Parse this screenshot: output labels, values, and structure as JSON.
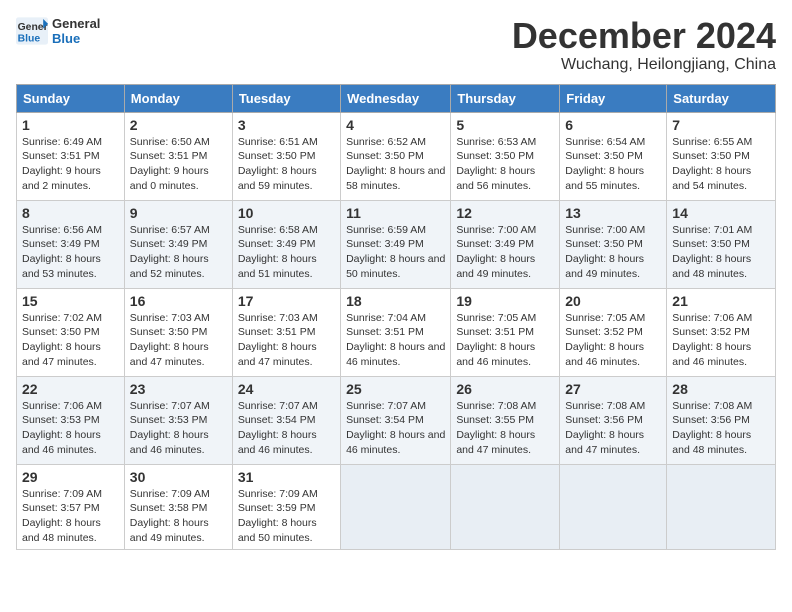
{
  "header": {
    "logo_general": "General",
    "logo_blue": "Blue",
    "month_title": "December 2024",
    "subtitle": "Wuchang, Heilongjiang, China"
  },
  "columns": [
    "Sunday",
    "Monday",
    "Tuesday",
    "Wednesday",
    "Thursday",
    "Friday",
    "Saturday"
  ],
  "weeks": [
    [
      {
        "day": "1",
        "sunrise": "Sunrise: 6:49 AM",
        "sunset": "Sunset: 3:51 PM",
        "daylight": "Daylight: 9 hours and 2 minutes."
      },
      {
        "day": "2",
        "sunrise": "Sunrise: 6:50 AM",
        "sunset": "Sunset: 3:51 PM",
        "daylight": "Daylight: 9 hours and 0 minutes."
      },
      {
        "day": "3",
        "sunrise": "Sunrise: 6:51 AM",
        "sunset": "Sunset: 3:50 PM",
        "daylight": "Daylight: 8 hours and 59 minutes."
      },
      {
        "day": "4",
        "sunrise": "Sunrise: 6:52 AM",
        "sunset": "Sunset: 3:50 PM",
        "daylight": "Daylight: 8 hours and 58 minutes."
      },
      {
        "day": "5",
        "sunrise": "Sunrise: 6:53 AM",
        "sunset": "Sunset: 3:50 PM",
        "daylight": "Daylight: 8 hours and 56 minutes."
      },
      {
        "day": "6",
        "sunrise": "Sunrise: 6:54 AM",
        "sunset": "Sunset: 3:50 PM",
        "daylight": "Daylight: 8 hours and 55 minutes."
      },
      {
        "day": "7",
        "sunrise": "Sunrise: 6:55 AM",
        "sunset": "Sunset: 3:50 PM",
        "daylight": "Daylight: 8 hours and 54 minutes."
      }
    ],
    [
      {
        "day": "8",
        "sunrise": "Sunrise: 6:56 AM",
        "sunset": "Sunset: 3:49 PM",
        "daylight": "Daylight: 8 hours and 53 minutes."
      },
      {
        "day": "9",
        "sunrise": "Sunrise: 6:57 AM",
        "sunset": "Sunset: 3:49 PM",
        "daylight": "Daylight: 8 hours and 52 minutes."
      },
      {
        "day": "10",
        "sunrise": "Sunrise: 6:58 AM",
        "sunset": "Sunset: 3:49 PM",
        "daylight": "Daylight: 8 hours and 51 minutes."
      },
      {
        "day": "11",
        "sunrise": "Sunrise: 6:59 AM",
        "sunset": "Sunset: 3:49 PM",
        "daylight": "Daylight: 8 hours and 50 minutes."
      },
      {
        "day": "12",
        "sunrise": "Sunrise: 7:00 AM",
        "sunset": "Sunset: 3:49 PM",
        "daylight": "Daylight: 8 hours and 49 minutes."
      },
      {
        "day": "13",
        "sunrise": "Sunrise: 7:00 AM",
        "sunset": "Sunset: 3:50 PM",
        "daylight": "Daylight: 8 hours and 49 minutes."
      },
      {
        "day": "14",
        "sunrise": "Sunrise: 7:01 AM",
        "sunset": "Sunset: 3:50 PM",
        "daylight": "Daylight: 8 hours and 48 minutes."
      }
    ],
    [
      {
        "day": "15",
        "sunrise": "Sunrise: 7:02 AM",
        "sunset": "Sunset: 3:50 PM",
        "daylight": "Daylight: 8 hours and 47 minutes."
      },
      {
        "day": "16",
        "sunrise": "Sunrise: 7:03 AM",
        "sunset": "Sunset: 3:50 PM",
        "daylight": "Daylight: 8 hours and 47 minutes."
      },
      {
        "day": "17",
        "sunrise": "Sunrise: 7:03 AM",
        "sunset": "Sunset: 3:51 PM",
        "daylight": "Daylight: 8 hours and 47 minutes."
      },
      {
        "day": "18",
        "sunrise": "Sunrise: 7:04 AM",
        "sunset": "Sunset: 3:51 PM",
        "daylight": "Daylight: 8 hours and 46 minutes."
      },
      {
        "day": "19",
        "sunrise": "Sunrise: 7:05 AM",
        "sunset": "Sunset: 3:51 PM",
        "daylight": "Daylight: 8 hours and 46 minutes."
      },
      {
        "day": "20",
        "sunrise": "Sunrise: 7:05 AM",
        "sunset": "Sunset: 3:52 PM",
        "daylight": "Daylight: 8 hours and 46 minutes."
      },
      {
        "day": "21",
        "sunrise": "Sunrise: 7:06 AM",
        "sunset": "Sunset: 3:52 PM",
        "daylight": "Daylight: 8 hours and 46 minutes."
      }
    ],
    [
      {
        "day": "22",
        "sunrise": "Sunrise: 7:06 AM",
        "sunset": "Sunset: 3:53 PM",
        "daylight": "Daylight: 8 hours and 46 minutes."
      },
      {
        "day": "23",
        "sunrise": "Sunrise: 7:07 AM",
        "sunset": "Sunset: 3:53 PM",
        "daylight": "Daylight: 8 hours and 46 minutes."
      },
      {
        "day": "24",
        "sunrise": "Sunrise: 7:07 AM",
        "sunset": "Sunset: 3:54 PM",
        "daylight": "Daylight: 8 hours and 46 minutes."
      },
      {
        "day": "25",
        "sunrise": "Sunrise: 7:07 AM",
        "sunset": "Sunset: 3:54 PM",
        "daylight": "Daylight: 8 hours and 46 minutes."
      },
      {
        "day": "26",
        "sunrise": "Sunrise: 7:08 AM",
        "sunset": "Sunset: 3:55 PM",
        "daylight": "Daylight: 8 hours and 47 minutes."
      },
      {
        "day": "27",
        "sunrise": "Sunrise: 7:08 AM",
        "sunset": "Sunset: 3:56 PM",
        "daylight": "Daylight: 8 hours and 47 minutes."
      },
      {
        "day": "28",
        "sunrise": "Sunrise: 7:08 AM",
        "sunset": "Sunset: 3:56 PM",
        "daylight": "Daylight: 8 hours and 48 minutes."
      }
    ],
    [
      {
        "day": "29",
        "sunrise": "Sunrise: 7:09 AM",
        "sunset": "Sunset: 3:57 PM",
        "daylight": "Daylight: 8 hours and 48 minutes."
      },
      {
        "day": "30",
        "sunrise": "Sunrise: 7:09 AM",
        "sunset": "Sunset: 3:58 PM",
        "daylight": "Daylight: 8 hours and 49 minutes."
      },
      {
        "day": "31",
        "sunrise": "Sunrise: 7:09 AM",
        "sunset": "Sunset: 3:59 PM",
        "daylight": "Daylight: 8 hours and 50 minutes."
      },
      null,
      null,
      null,
      null
    ]
  ]
}
